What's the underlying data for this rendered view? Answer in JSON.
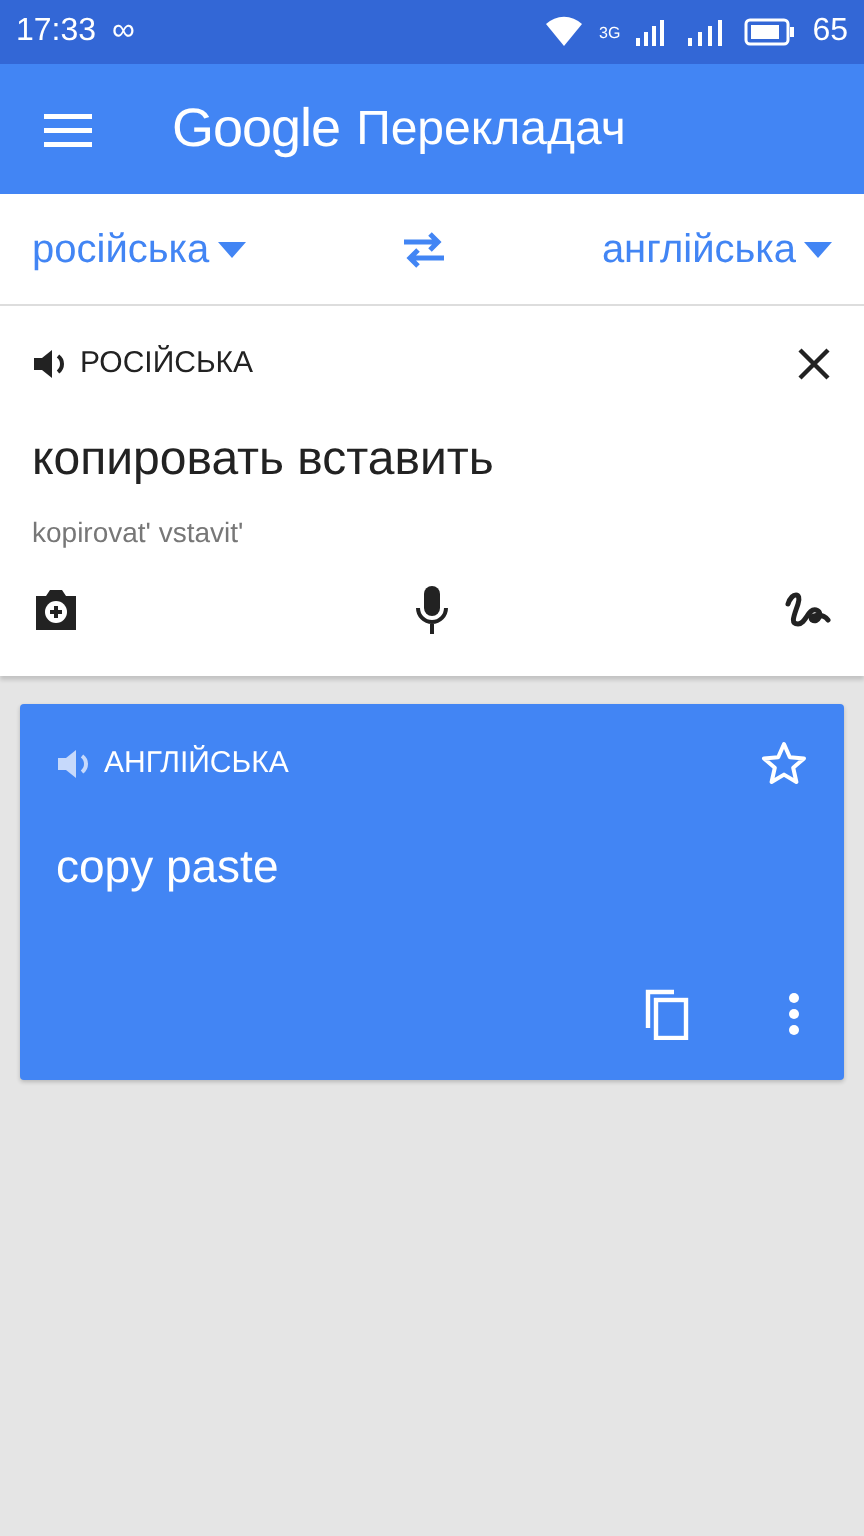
{
  "status_bar": {
    "time": "17:33",
    "loop_glyph": "∞",
    "network_label": "3G",
    "battery": "65"
  },
  "app_bar": {
    "brand": "Google",
    "title": "Перекладач"
  },
  "languages": {
    "source": "російська",
    "target": "англійська"
  },
  "input": {
    "language": "РОСІЙСЬКА",
    "text": "копировать вставить",
    "transliteration": "kopirovat' vstavit'"
  },
  "result": {
    "language": "АНГЛІЙСЬКА",
    "text": "copy paste",
    "starred": false
  }
}
